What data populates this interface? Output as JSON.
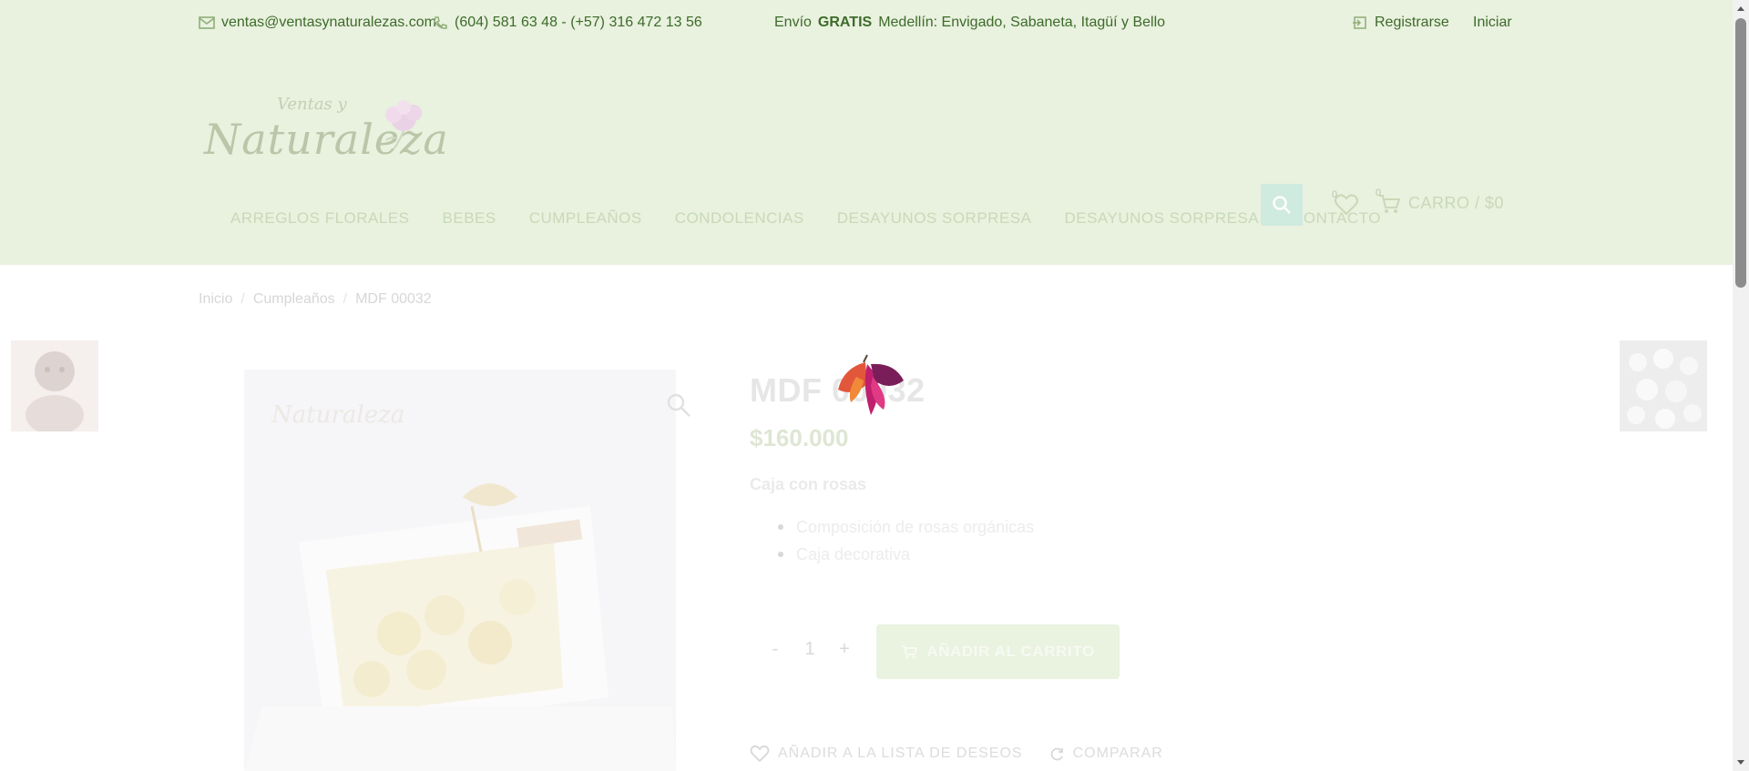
{
  "topbar": {
    "email": "ventas@ventasynaturalezas.com",
    "phone": "(604) 581 63 48 - (+57) 316 472 13 56",
    "promo_prefix": "Envío",
    "promo_bold": "GRATIS",
    "promo_suffix": "Medellín: Envigado, Sabaneta, Itagüí y Bello",
    "account": "Registrarse",
    "login": "Iniciar"
  },
  "logo": {
    "name": "Naturaleza",
    "sub": "Ventas y",
    "icon": "flower-logo-icon"
  },
  "nav": {
    "items": [
      "Arreglos florales",
      "Bebes",
      "Cumpleaños",
      "Condolencias",
      "Desayunos sorpresa",
      "Desayunos sorpresa",
      "Contacto"
    ]
  },
  "header": {
    "wishlist_count": "0",
    "cart_count": "0",
    "cart_label": "CARRO / $0"
  },
  "breadcrumb": [
    "Inicio",
    "Cumpleaños",
    "MDF 00032"
  ],
  "product": {
    "title": "MDF 00032",
    "price": "$160.000",
    "subtitle": "Caja con rosas",
    "features": [
      "Composición de rosas orgánicas",
      "Caja decorativa"
    ],
    "quantity": "1",
    "qty_minus": "-",
    "qty_plus": "+",
    "add_to_cart": "AÑADIR AL CARRITO",
    "wishlist": "AÑADIR A LA LISTA DE DESEOS",
    "compare": "COMPARAR"
  },
  "colors": {
    "header_bg": "#e9f1df",
    "accent": "#3d6b2a",
    "search_bg": "#cfeadf"
  }
}
